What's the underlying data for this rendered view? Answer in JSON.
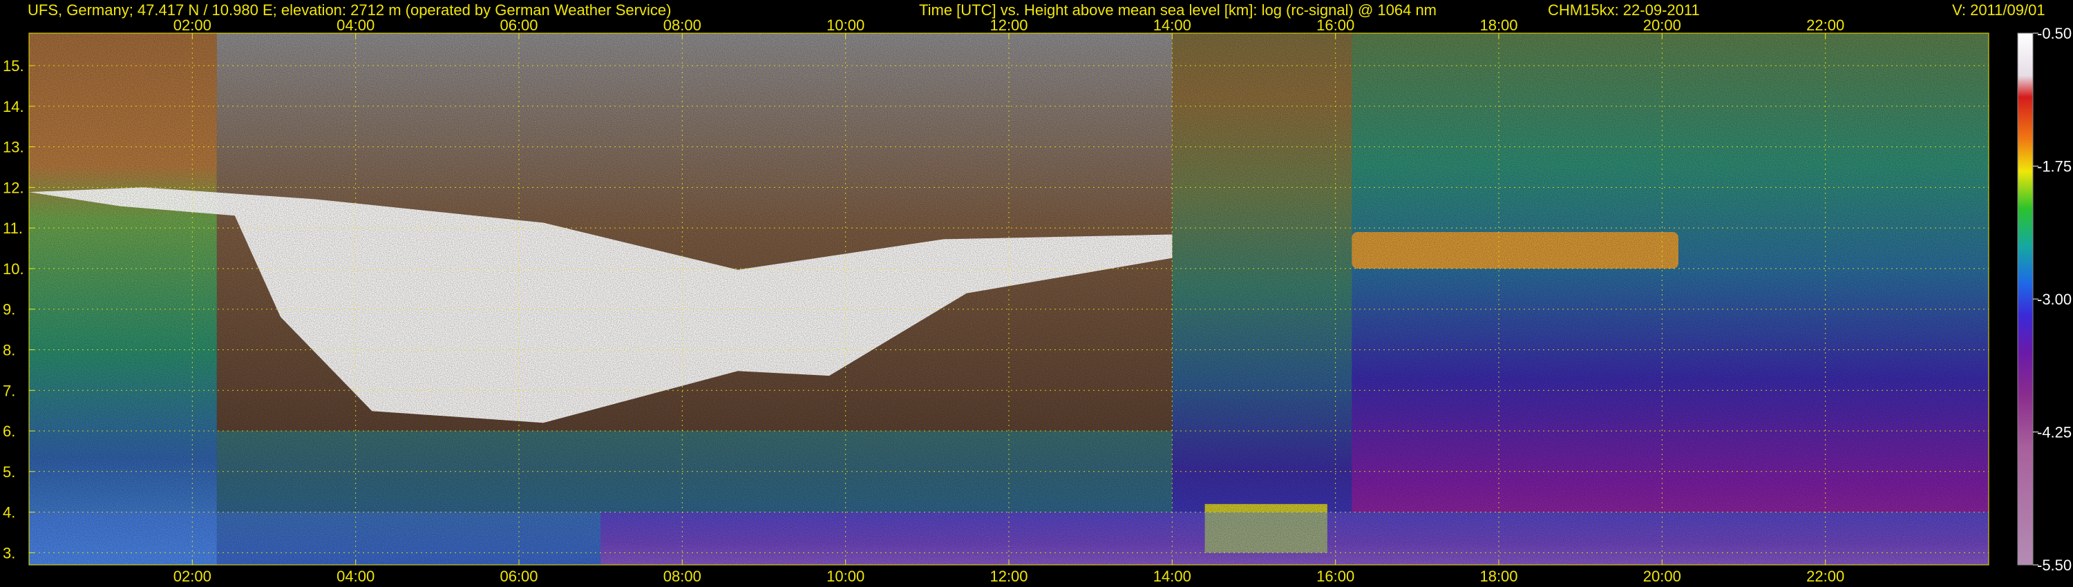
{
  "header": {
    "location": "UFS, Germany; 47.417 N / 10.980 E; elevation: 2712 m  (operated by German Weather Service)",
    "description": "Time [UTC] vs. Height above mean sea level [km]: log (rc-signal) @ 1064 nm",
    "instrument": "CHM15kx: 22-09-2011",
    "version": "V: 2011/09/01"
  },
  "colors": {
    "background": "#000000",
    "header_text": "#f0e60a",
    "grid": "#f0e60a",
    "tick_text": "#f0e60a",
    "colorbar_text": "#ffffff"
  },
  "chart_data": {
    "type": "heatmap",
    "title": "Time [UTC] vs. Height above mean sea level [km]: log (rc-signal) @ 1064 nm",
    "xlabel": "Time [UTC]",
    "ylabel": "Height above mean sea level [km]",
    "x_range_hours": [
      0,
      24
    ],
    "xticks_hours": [
      2,
      4,
      6,
      8,
      10,
      12,
      14,
      16,
      18,
      20,
      22
    ],
    "xtick_labels": [
      "02:00",
      "04:00",
      "06:00",
      "08:00",
      "10:00",
      "12:00",
      "14:00",
      "16:00",
      "18:00",
      "20:00",
      "22:00"
    ],
    "ylim": [
      2.7,
      15.8
    ],
    "yticks": [
      3,
      4,
      5,
      6,
      7,
      8,
      9,
      10,
      11,
      12,
      13,
      14,
      15
    ],
    "ytick_labels": [
      "3.",
      "4.",
      "5.",
      "6.",
      "7.",
      "8.",
      "9.",
      "10.",
      "11.",
      "12.",
      "13.",
      "14.",
      "15."
    ],
    "grid": true,
    "colorbar": {
      "range": [
        -5.5,
        -0.5
      ],
      "ticks": [
        -0.5,
        -1.75,
        -3.0,
        -4.25,
        -5.5
      ],
      "tick_labels": [
        "-0.50",
        "-1.75",
        "-3.00",
        "-4.25",
        "-5.50"
      ],
      "palette": [
        "#ffffff",
        "#e6dde6",
        "#d41c1c",
        "#f07a12",
        "#f0e60a",
        "#2cc22c",
        "#15a8a0",
        "#1e6ae6",
        "#3a2ad8",
        "#6a1aa8",
        "#8a2c8e",
        "#a8609c",
        "#b48cb4"
      ]
    },
    "features": [
      {
        "name": "cirrus cloud layer",
        "time_hours": [
          0.0,
          14.0
        ],
        "height_km": [
          6.2,
          12.0
        ]
      },
      {
        "name": "cirrus cloud layer",
        "time_hours": [
          16.2,
          20.2
        ],
        "height_km": [
          10.0,
          10.9
        ]
      },
      {
        "name": "low cloud",
        "time_hours": [
          14.4,
          15.9
        ],
        "height_km": [
          3.0,
          4.2
        ]
      },
      {
        "name": "boundary layer",
        "time_hours": [
          0.0,
          24.0
        ],
        "height_km": [
          2.7,
          4.0
        ]
      }
    ]
  }
}
